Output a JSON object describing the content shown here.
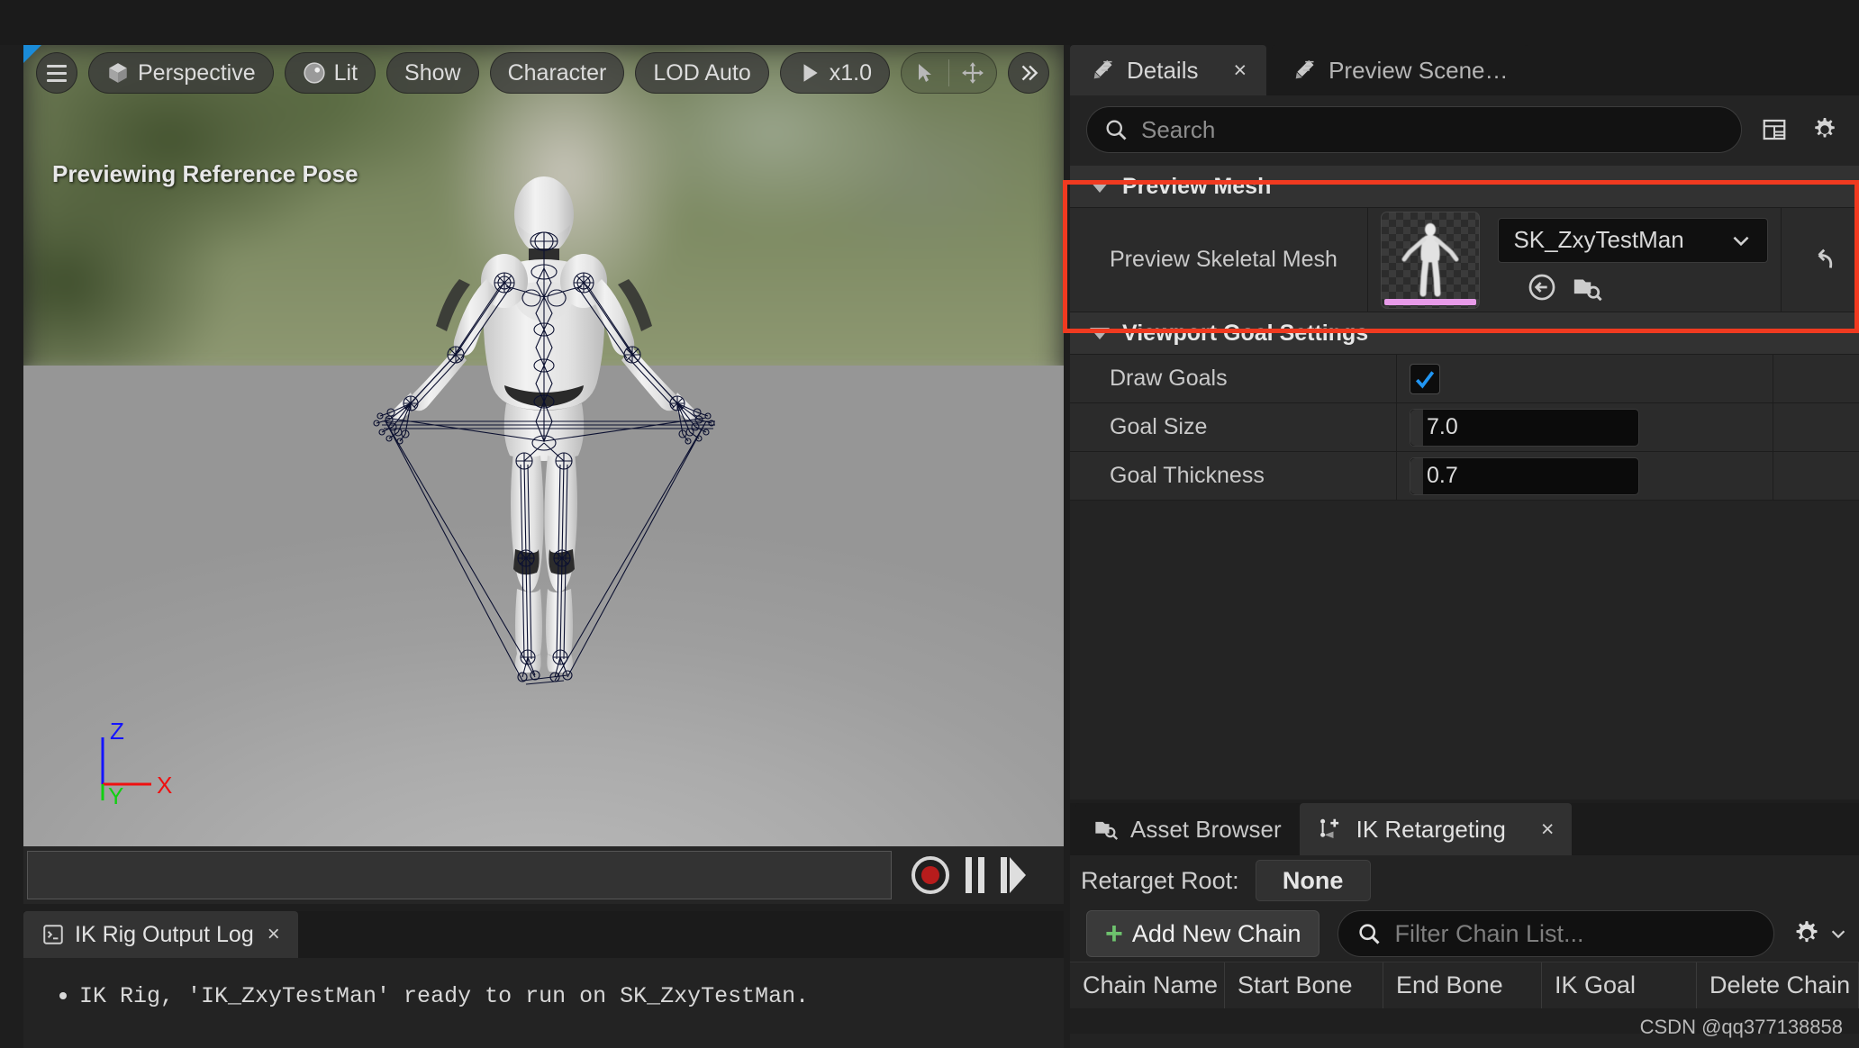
{
  "viewport": {
    "toolbar": {
      "menu_icon": "hamburger-icon",
      "perspective_label": "Perspective",
      "lit_label": "Lit",
      "show_label": "Show",
      "character_label": "Character",
      "lod_label": "LOD Auto",
      "playrate_label": "x1.0",
      "select_icon": "cursor-arrow-icon",
      "move_icon": "move-gizmo-icon",
      "more_icon": "double-chevron-right-icon"
    },
    "status_text": "Previewing Reference Pose",
    "axis": {
      "x": "X",
      "y": "Y",
      "z": "Z"
    },
    "timeline": {
      "record_icon": "record-icon",
      "pause_icon": "pause-icon",
      "step_icon": "step-forward-icon"
    }
  },
  "output_log": {
    "tab_label": "IK Rig Output Log",
    "tab_close": "×",
    "tab_icon": "console-log-icon",
    "lines": [
      "IK Rig, 'IK_ZxyTestMan' ready to run on SK_ZxyTestMan."
    ]
  },
  "details": {
    "tabs": [
      {
        "label": "Details",
        "icon": "details-pencil-icon",
        "active": true,
        "closable": true,
        "close": "×"
      },
      {
        "label": "Preview Scene…",
        "icon": "details-pencil-icon",
        "active": false,
        "closable": false,
        "close": ""
      }
    ],
    "search": {
      "placeholder": "Search",
      "icon": "search-icon"
    },
    "header_icons": [
      {
        "name": "column-layout-icon"
      },
      {
        "name": "settings-gear-icon"
      }
    ],
    "sections": [
      {
        "title": "Preview Mesh",
        "expanded": true,
        "highlighted": true,
        "rows": [
          {
            "label": "Preview Skeletal Mesh",
            "type": "asset",
            "value": "SK_ZxyTestMan",
            "thumbnail": "skeletal-mesh-thumbnail",
            "dropdown_icon": "chevron-down-icon",
            "use_selected_icon": "use-selected-asset-icon",
            "browse_icon": "browse-to-asset-icon",
            "reset_icon": "reset-to-default-icon"
          }
        ]
      },
      {
        "title": "Viewport Goal Settings",
        "expanded": true,
        "highlighted": false,
        "rows": [
          {
            "label": "Draw Goals",
            "type": "checkbox",
            "checked": true
          },
          {
            "label": "Goal Size",
            "type": "number",
            "value": "7.0"
          },
          {
            "label": "Goal Thickness",
            "type": "number",
            "value": "0.7"
          }
        ]
      }
    ]
  },
  "retargeting": {
    "tabs": [
      {
        "label": "Asset Browser",
        "icon": "asset-browser-icon",
        "active": false,
        "close": ""
      },
      {
        "label": "IK Retargeting",
        "icon": "ik-retarget-icon",
        "active": true,
        "close": "×"
      }
    ],
    "retarget_root_label": "Retarget Root:",
    "retarget_root_value": "None",
    "add_chain_label": "Add New Chain",
    "add_chain_plus": "+",
    "filter_placeholder": "Filter Chain List...",
    "filter_icon": "search-icon",
    "settings_icon": "settings-gear-icon",
    "settings_chevron": "chevron-down-icon",
    "columns": [
      "Chain Name",
      "Start Bone",
      "End Bone",
      "IK Goal",
      "Delete Chain"
    ],
    "rows": []
  },
  "watermark": "CSDN @qq377138858",
  "colors": {
    "highlight": "#f03a20",
    "accent_blue": "#1a8bd8",
    "checkbox_blue": "#2196f3",
    "plus_green": "#6ec26e",
    "thumb_bar": "#e79ae8"
  }
}
